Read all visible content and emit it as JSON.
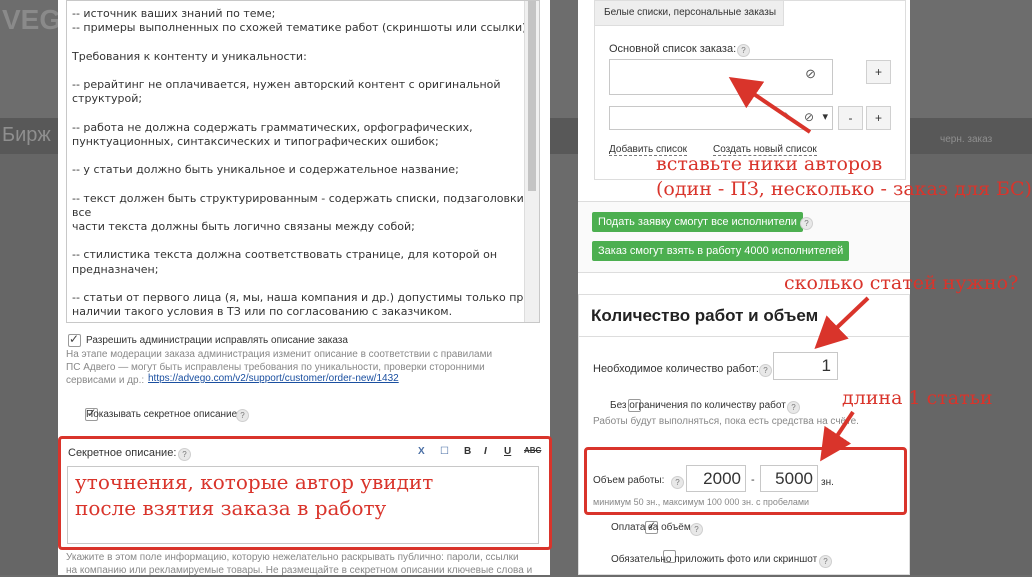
{
  "background": {
    "logo_fragment": "VEG",
    "section_fragment": "Бирж",
    "header_link": "черн. заказ"
  },
  "description": {
    "lines": [
      "-- источник ваших знаний по теме;",
      "-- примеры выполненных по схожей тематике работ (скриншоты или ссылки).",
      "",
      "Требования к контенту и уникальности:",
      "",
      "-- рерайтинг не оплачивается, нужен авторский контент с оригинальной",
      "структурой;",
      "",
      "-- работа не должна содержать грамматических, орфографических,",
      "пунктуационных, синтаксических и типографических ошибок;",
      "",
      "-- у статьи должно быть уникальное и содержательное название;",
      "",
      "-- текст должен быть структурированным - содержать списки, подзаголовки, все",
      "части текста должны быть логично связаны между собой;",
      "",
      "-- стилистика текста должна соответствовать странице, для которой он",
      "предназначен;",
      "",
      "-- статьи от первого лица (я, мы, наша компания и др.) допустимы только при",
      "наличии такого условия в ТЗ или по согласованию с заказчиком.",
      "--"
    ]
  },
  "allow_admin": {
    "label": "Разрешить администрации исправлять описание заказа",
    "note_lines": [
      "На этапе модерации заказа администрация изменит описание в соответствии с правилами",
      "ПС Адвего — могут быть исправлены требования по уникальности, проверки сторонними",
      "сервисами и др.:"
    ],
    "link": "https://advego.com/v2/support/customer/order-new/1432"
  },
  "show_secret": {
    "label": "Показывать секретное описание"
  },
  "secret": {
    "label": "Секретное описание:",
    "toolbar": [
      "X",
      "☐",
      "B",
      "I",
      "U",
      "ABC"
    ],
    "annotation_line1": "уточнения, которые автор увидит",
    "annotation_line2": "после взятия заказа в работу",
    "note_lines": [
      "Укажите в этом поле информацию, которую нежелательно раскрывать публично: пароли, ссылки",
      "на компанию или рекламируемые товары. Не размещайте в секретном описании ключевые слова и"
    ]
  },
  "whitelist": {
    "tab": "Белые списки, персональные заказы",
    "main_label": "Основной список заказа:",
    "add_btn": "+",
    "minus_btn": "-",
    "plus_btn2": "+",
    "add_list": "Добавить список",
    "create_list": "Создать новый список",
    "annotation_line1": "вставьте ники авторов",
    "annotation_line2": "(один - ПЗ, несколько - заказ для БС)"
  },
  "green_buttons": {
    "apply_all": "Подать заявку смогут все исполнители",
    "take_4000": "Заказ смогут взять в работу 4000 исполнителей"
  },
  "quantity": {
    "annotation_count": "сколько статей нужно?",
    "title": "Количество работ и объем",
    "needed_label": "Необходимое количество работ:",
    "needed_value": "1",
    "annotation_length": "длина 1 статьи",
    "unlimited_label": "Без ограничения по количеству работ",
    "unlimited_note": "Работы будут выполняться, пока есть средства на счёте.",
    "volume_label": "Объем работы:",
    "volume_min": "2000",
    "dash": "-",
    "volume_max": "5000",
    "unit": "зн.",
    "volume_note": "минимум 50 зн., максимум 100 000 зн. с пробелами",
    "pay_volume": "Оплата за объём",
    "attach_photo": "Обязательно приложить фото или скриншот"
  },
  "colors": {
    "accent_red": "#d9342b",
    "green": "#4caf50"
  }
}
